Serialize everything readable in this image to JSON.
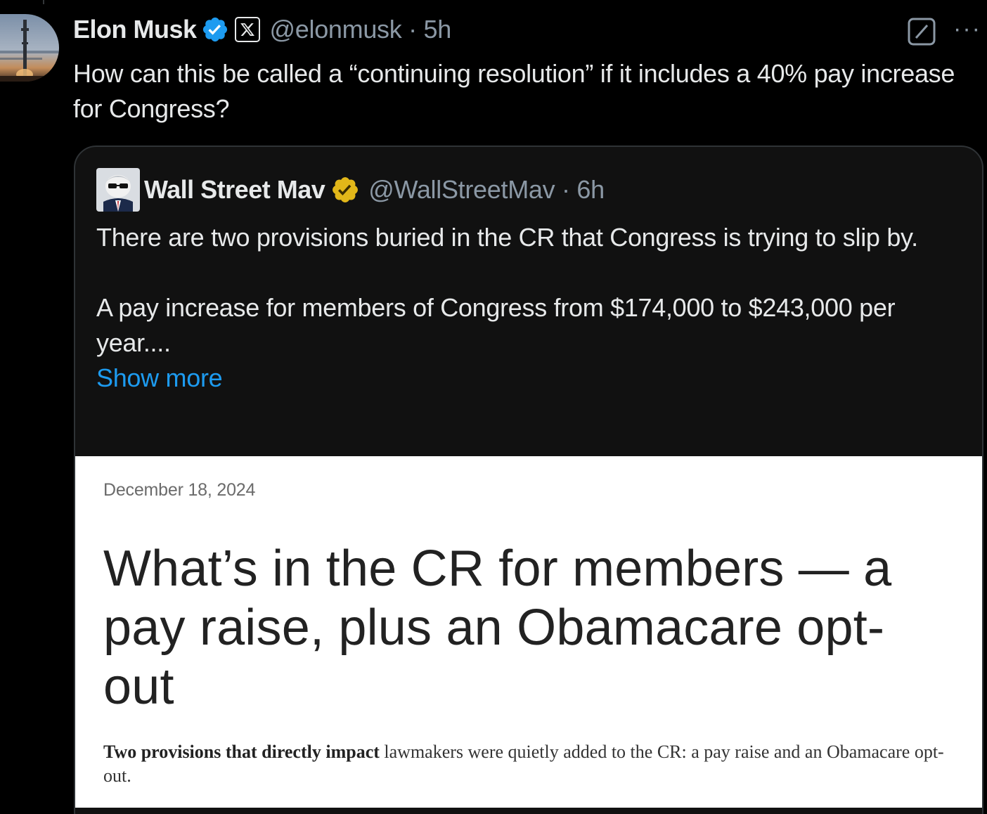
{
  "tweet": {
    "author_name": "Elon Musk",
    "handle_time": "@elonmusk · 5h",
    "affiliate_badge_icon": "x-logo-icon",
    "text": "How can this be called a “continuing resolution” if it includes a 40% pay increase for Congress?",
    "more_label": "···"
  },
  "quote": {
    "author_name": "Wall Street Mav",
    "handle_time": "@WallStreetMav · 6h",
    "paragraph_1": "There are two provisions buried in the CR that Congress is trying to slip by.",
    "paragraph_2": "A pay increase for members of Congress from $174,000 to $243,000 per year....",
    "show_more": "Show more",
    "image": {
      "date": "December 18, 2024",
      "headline": "What’s in the CR for members — a pay raise, plus an Obamacare opt-out",
      "subheading_bold": "Two provisions that directly impact",
      "subheading_rest": " lawmakers were quietly added to the CR: a pay raise and an Obamacare opt-out."
    }
  },
  "colors": {
    "background": "#000000",
    "text_primary": "#e7e9ea",
    "text_secondary": "#8b98a5",
    "link": "#1d9bf0",
    "verified_blue": "#1d9bf0",
    "verified_gold": "#e2b719"
  }
}
